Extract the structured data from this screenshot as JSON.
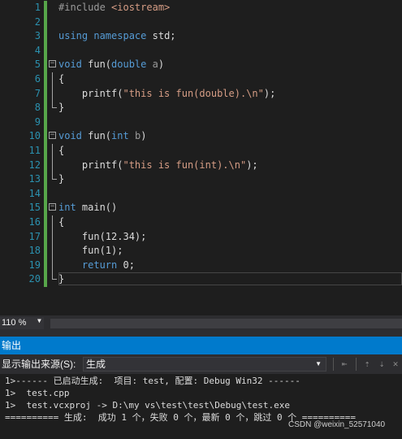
{
  "editor": {
    "lines": [
      {
        "n": "1",
        "segs": [
          [
            "pp",
            "#include "
          ],
          [
            "inc",
            "<iostream>"
          ]
        ]
      },
      {
        "n": "2",
        "segs": []
      },
      {
        "n": "3",
        "segs": [
          [
            "kw",
            "using"
          ],
          [
            "",
            " "
          ],
          [
            "kw",
            "namespace"
          ],
          [
            "",
            " std;"
          ]
        ]
      },
      {
        "n": "4",
        "segs": []
      },
      {
        "n": "5",
        "fold": "open",
        "segs": [
          [
            "kw",
            "void"
          ],
          [
            "",
            " fun("
          ],
          [
            "kw",
            "double"
          ],
          [
            "",
            " "
          ],
          [
            "prm",
            "a"
          ],
          [
            "",
            ")"
          ]
        ]
      },
      {
        "n": "6",
        "guide": "line",
        "segs": [
          [
            "",
            "{"
          ]
        ]
      },
      {
        "n": "7",
        "guide": "line",
        "segs": [
          [
            "",
            "    printf("
          ],
          [
            "str",
            "\"this is fun(double).\\n\""
          ],
          [
            "",
            ");"
          ]
        ]
      },
      {
        "n": "8",
        "guide": "end",
        "segs": [
          [
            "",
            "}"
          ]
        ]
      },
      {
        "n": "9",
        "segs": []
      },
      {
        "n": "10",
        "fold": "open",
        "segs": [
          [
            "kw",
            "void"
          ],
          [
            "",
            " fun("
          ],
          [
            "kw",
            "int"
          ],
          [
            "",
            " "
          ],
          [
            "prm",
            "b"
          ],
          [
            "",
            ")"
          ]
        ]
      },
      {
        "n": "11",
        "guide": "line",
        "segs": [
          [
            "",
            "{"
          ]
        ]
      },
      {
        "n": "12",
        "guide": "line",
        "segs": [
          [
            "",
            "    printf("
          ],
          [
            "str",
            "\"this is fun(int).\\n\""
          ],
          [
            "",
            ");"
          ]
        ]
      },
      {
        "n": "13",
        "guide": "end",
        "segs": [
          [
            "",
            "}"
          ]
        ]
      },
      {
        "n": "14",
        "segs": []
      },
      {
        "n": "15",
        "fold": "open",
        "segs": [
          [
            "kw",
            "int"
          ],
          [
            "",
            " main()"
          ]
        ]
      },
      {
        "n": "16",
        "guide": "line",
        "segs": [
          [
            "",
            "{"
          ]
        ]
      },
      {
        "n": "17",
        "guide": "line",
        "segs": [
          [
            "",
            "    fun(12.34);"
          ]
        ]
      },
      {
        "n": "18",
        "guide": "line",
        "segs": [
          [
            "",
            "    fun(1);"
          ]
        ]
      },
      {
        "n": "19",
        "guide": "line",
        "segs": [
          [
            "",
            "    "
          ],
          [
            "kw",
            "return"
          ],
          [
            "",
            " 0;"
          ]
        ]
      },
      {
        "n": "20",
        "guide": "end",
        "current": true,
        "segs": [
          [
            "",
            "}"
          ]
        ]
      }
    ]
  },
  "zoom": {
    "value": "110 %"
  },
  "panel": {
    "title": "输出",
    "source_label": "显示输出来源(S):",
    "source_value": "生成"
  },
  "output": {
    "lines": [
      "1>------ 已启动生成:  项目: test, 配置: Debug Win32 ------",
      "1>  test.cpp",
      "1>  test.vcxproj -> D:\\my vs\\test\\test\\Debug\\test.exe",
      "========== 生成:  成功 1 个，失败 0 个，最新 0 个，跳过 0 个 =========="
    ]
  },
  "watermark": "CSDN @weixin_52571040",
  "colors": {
    "keyword": "#569cd6",
    "string": "#d69d85",
    "line_number": "#2b91af",
    "change_bar": "#57a64a",
    "panel_title_bg": "#007acc"
  }
}
